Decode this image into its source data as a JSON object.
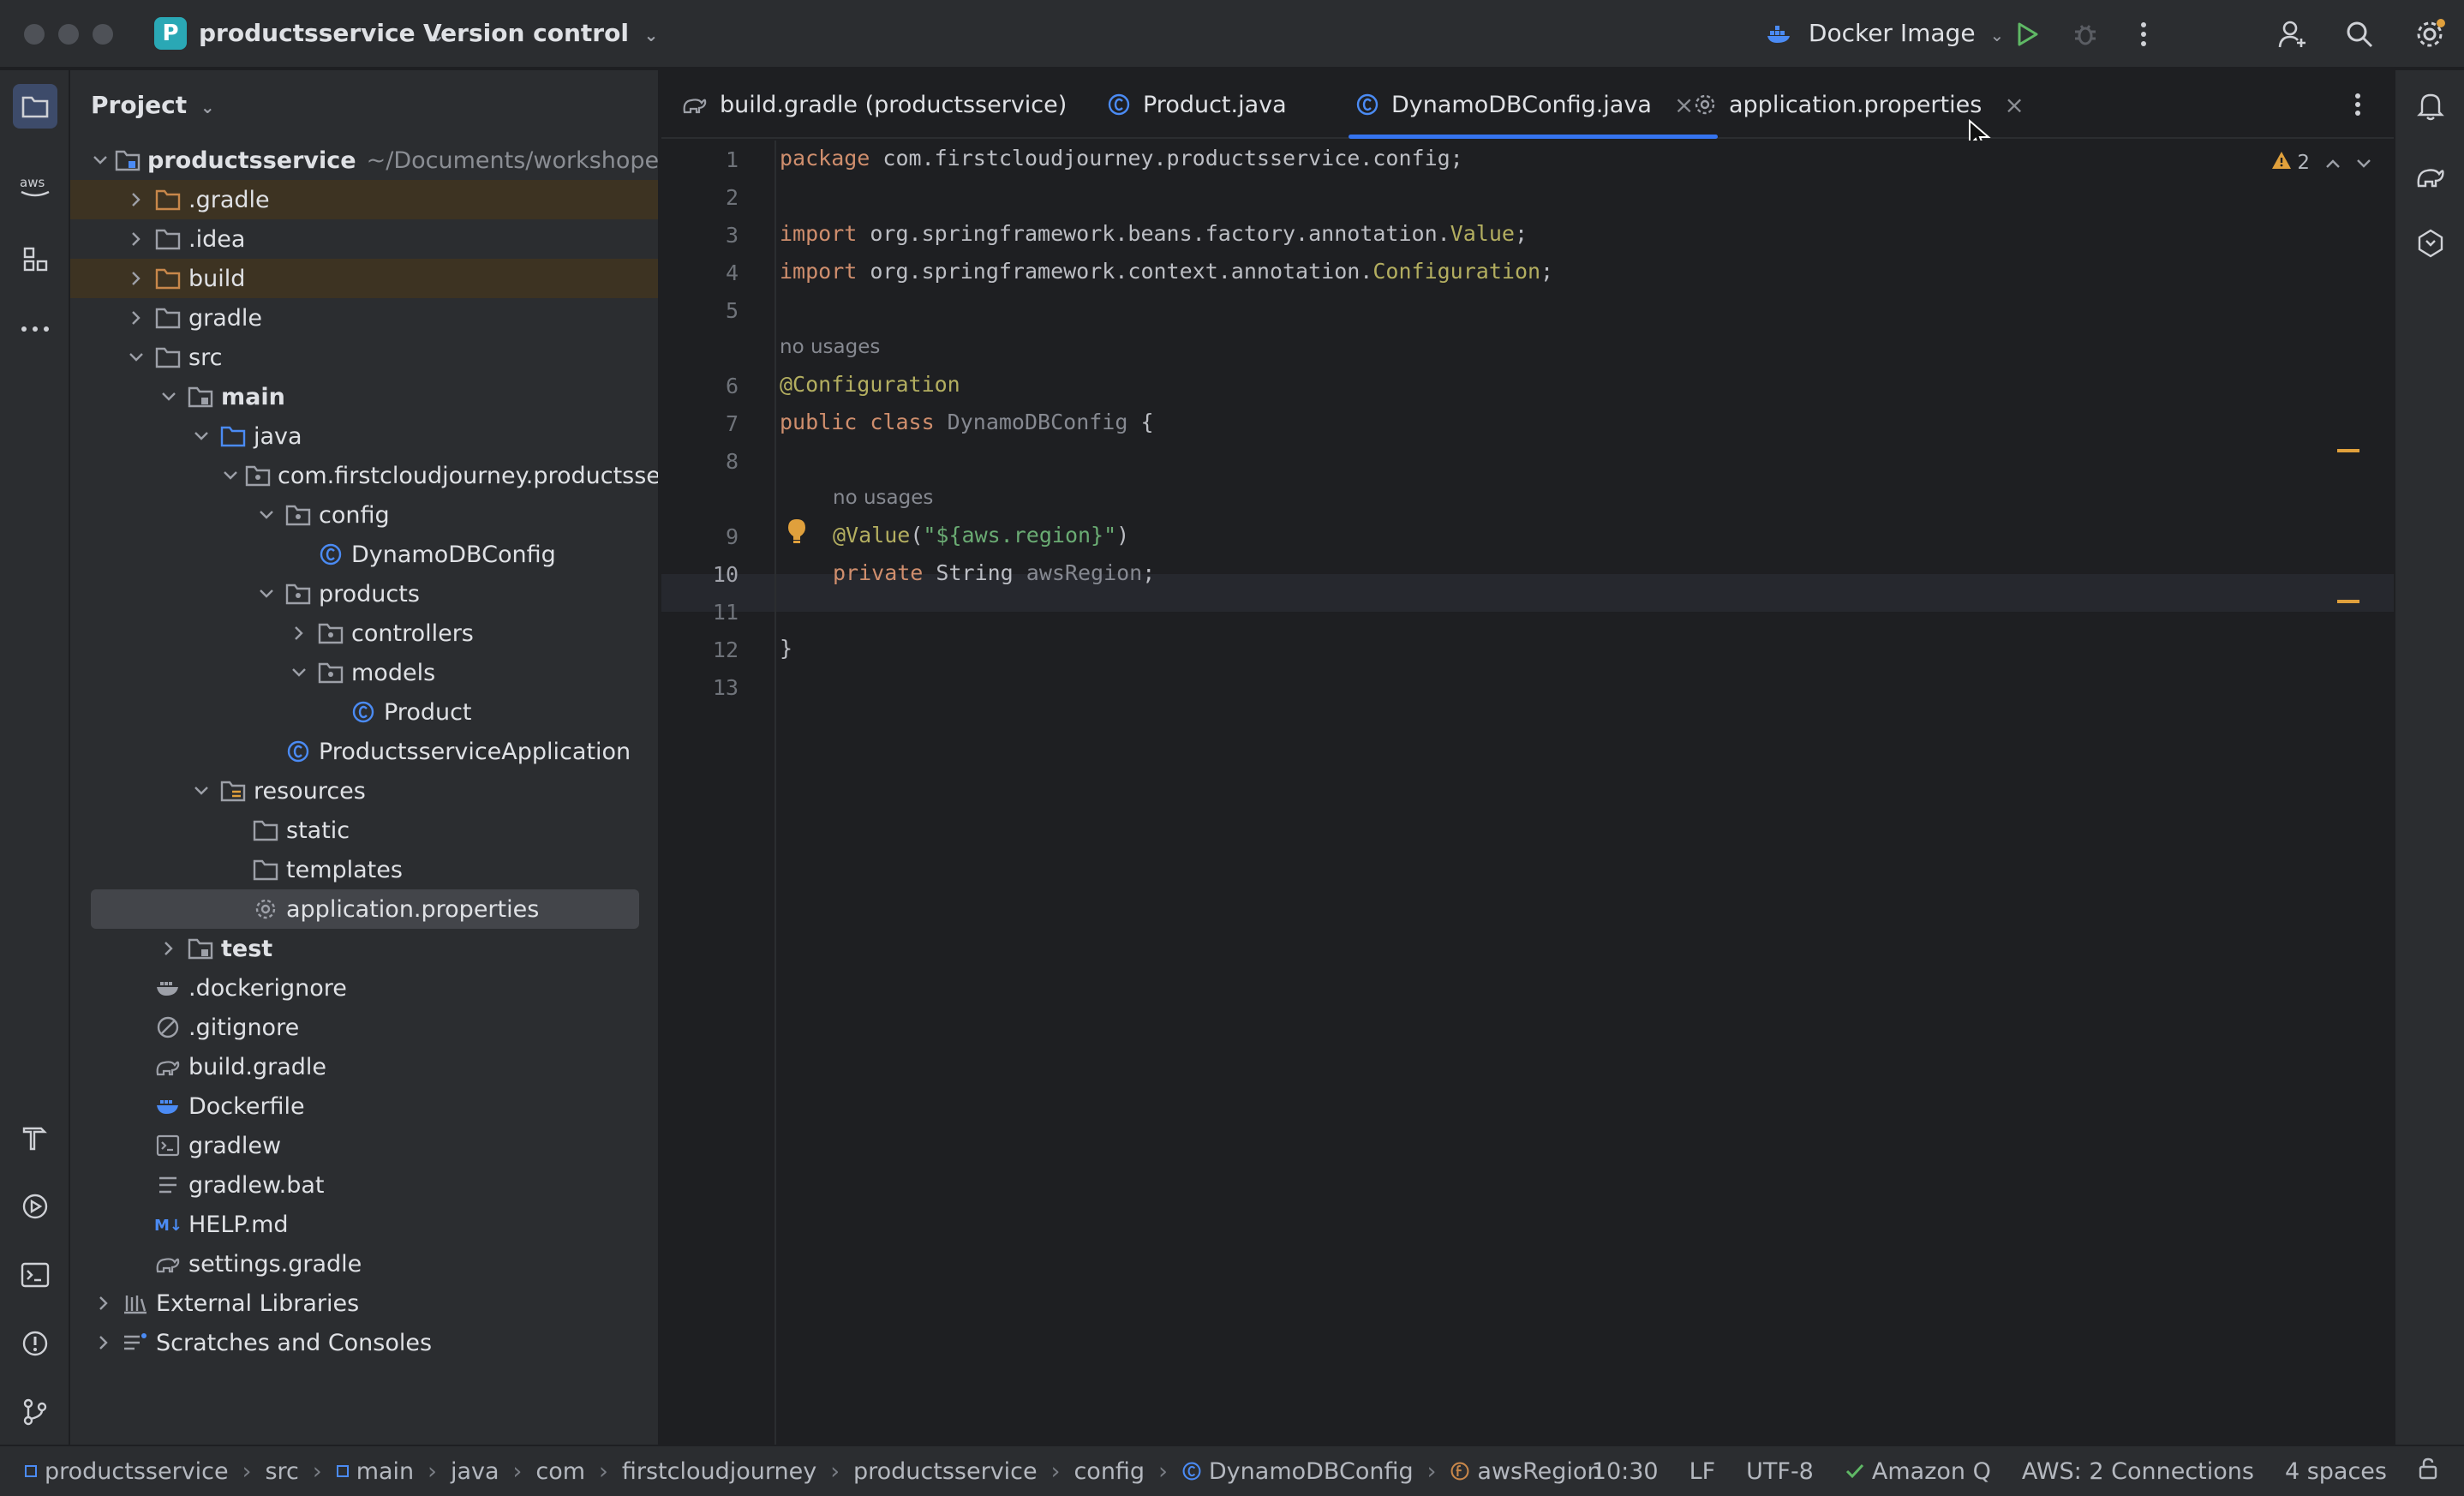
{
  "titlebar": {
    "project_badge": "P",
    "project_name": "productsservice",
    "version_control": "Version control",
    "run_config": "Docker Image"
  },
  "project_panel": {
    "title": "Project",
    "root": {
      "name": "productsservice",
      "path": "~/Documents/workshope/proc"
    },
    "items": [
      {
        "label": ".gradle"
      },
      {
        "label": ".idea"
      },
      {
        "label": "build"
      },
      {
        "label": "gradle"
      },
      {
        "label": "src"
      },
      {
        "label": "main"
      },
      {
        "label": "java"
      },
      {
        "label": "com.firstcloudjourney.productsserv"
      },
      {
        "label": "config"
      },
      {
        "label": "DynamoDBConfig"
      },
      {
        "label": "products"
      },
      {
        "label": "controllers"
      },
      {
        "label": "models"
      },
      {
        "label": "Product"
      },
      {
        "label": "ProductsserviceApplication"
      },
      {
        "label": "resources"
      },
      {
        "label": "static"
      },
      {
        "label": "templates"
      },
      {
        "label": "application.properties"
      },
      {
        "label": "test"
      },
      {
        "label": ".dockerignore"
      },
      {
        "label": ".gitignore"
      },
      {
        "label": "build.gradle"
      },
      {
        "label": "Dockerfile"
      },
      {
        "label": "gradlew"
      },
      {
        "label": "gradlew.bat"
      },
      {
        "label": "HELP.md"
      },
      {
        "label": "settings.gradle"
      },
      {
        "label": "External Libraries"
      },
      {
        "label": "Scratches and Consoles"
      }
    ]
  },
  "tabs": [
    {
      "label": "build.gradle (productsservice)"
    },
    {
      "label": "Product.java"
    },
    {
      "label": "DynamoDBConfig.java"
    },
    {
      "label": "application.properties"
    }
  ],
  "editor": {
    "warnings": "2",
    "line_numbers": [
      "1",
      "2",
      "3",
      "4",
      "5",
      "6",
      "7",
      "8",
      "9",
      "10",
      "11",
      "12",
      "13"
    ],
    "hint_no_usages": "no usages",
    "code": {
      "l1_kw": "package",
      "l1_rest": " com.firstcloudjourney.productsservice.config;",
      "l3_kw": "import",
      "l3_pkg": " org.springframework.beans.factory.annotation.",
      "l3_cls": "Value",
      "l3_end": ";",
      "l4_kw": "import",
      "l4_pkg": " org.springframework.context.annotation.",
      "l4_cls": "Configuration",
      "l4_end": ";",
      "l6_ann": "@Configuration",
      "l7_kw": "public class",
      "l7_name": " DynamoDBConfig",
      "l7_end": " {",
      "l9_ann": "@Value",
      "l9_p1": "(",
      "l9_str": "\"${aws.region}\"",
      "l9_p2": ")",
      "l10_kw": "private",
      "l10_type": " String",
      "l10_name": " awsRegion",
      "l10_end": ";",
      "l12": "}"
    }
  },
  "statusbar": {
    "breadcrumbs": [
      "productsservice",
      "src",
      "main",
      "java",
      "com",
      "firstcloudjourney",
      "productsservice",
      "config",
      "DynamoDBConfig",
      "awsRegion"
    ],
    "position": "10:30",
    "line_sep": "LF",
    "encoding": "UTF-8",
    "amazon_q": "Amazon Q",
    "aws": "AWS: 2 Connections",
    "indent": "4 spaces"
  },
  "colors": {
    "accent": "#3574f0",
    "warning": "#e0a03c",
    "keyword": "#cf8e6d",
    "annotation": "#b3ae60",
    "string": "#6aab73"
  }
}
